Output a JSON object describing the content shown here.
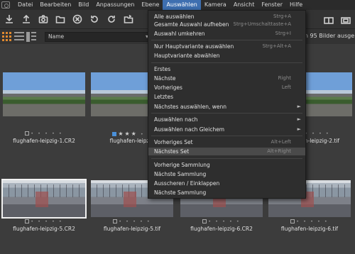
{
  "menubar": {
    "items": [
      "Datei",
      "Bearbeiten",
      "Bild",
      "Anpassungen",
      "Ebene",
      "Auswählen",
      "Kamera",
      "Ansicht",
      "Fenster",
      "Hilfe"
    ],
    "active_index": 5
  },
  "viewbar": {
    "sort_value": "Name",
    "count_text": "on 95 Bilder ausge"
  },
  "dropdown": {
    "items": [
      {
        "label": "Alle auswählen",
        "shortcut": "Strg+A"
      },
      {
        "label": "Gesamte Auswahl aufheben",
        "shortcut": "Strg+Umschalttaste+A"
      },
      {
        "label": "Auswahl umkehren",
        "shortcut": "Strg+I"
      },
      {
        "label": "Nur Hauptvariante auswählen",
        "shortcut": "Strg+Alt+A"
      },
      {
        "label": "Hauptvariante abwählen",
        "shortcut": ""
      },
      {
        "label": "Erstes",
        "shortcut": ""
      },
      {
        "label": "Nächste",
        "shortcut": "Right"
      },
      {
        "label": "Vorheriges",
        "shortcut": "Left"
      },
      {
        "label": "Letztes",
        "shortcut": ""
      },
      {
        "label": "Nächstes auswählen, wenn",
        "shortcut": ""
      },
      {
        "label": "Auswählen nach",
        "shortcut": ""
      },
      {
        "label": "Auswählen nach Gleichem",
        "shortcut": ""
      },
      {
        "label": "Vorheriges Set",
        "shortcut": "Alt+Left"
      },
      {
        "label": "Nächstes Set",
        "shortcut": "Alt+Right"
      },
      {
        "label": "Vorherige Sammlung",
        "shortcut": ""
      },
      {
        "label": "Nächste Sammlung",
        "shortcut": ""
      },
      {
        "label": "Ausscheren / Einklappen",
        "shortcut": ""
      },
      {
        "label": "Nächste Sammlung",
        "shortcut": ""
      }
    ],
    "highlighted": "Nächstes Set"
  },
  "thumbnails": {
    "row1": [
      {
        "name": "flughafen-leipzig-1.CR2",
        "rating": 0,
        "color_tag": false
      },
      {
        "name": "flughafen-leipzig",
        "rating": 3,
        "color_tag": true
      },
      {
        "name": "flughafen-leipzig-2.tif",
        "rating": 0,
        "color_tag": false
      }
    ],
    "row2": [
      {
        "name": "flughafen-leipzig-5.CR2",
        "rating": 0,
        "selected": true
      },
      {
        "name": "flughafen-leipzig-5.tif",
        "rating": 0
      },
      {
        "name": "flughafen-leipzig-6.CR2",
        "rating": 0
      },
      {
        "name": "flughafen-leipzig-6.tif",
        "rating": 0
      }
    ]
  }
}
